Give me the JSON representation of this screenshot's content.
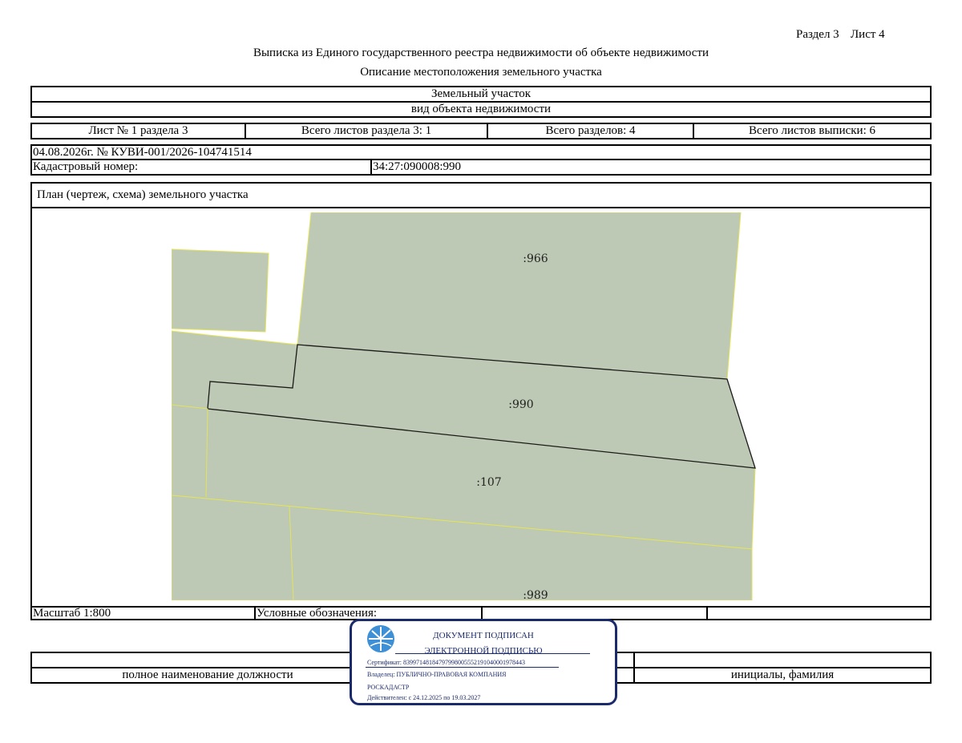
{
  "header": {
    "section": "Раздел 3",
    "sheet": "Лист 4",
    "title": "Выписка из Единого государственного реестра недвижимости об объекте недвижимости",
    "subtitle": "Описание местоположения земельного участка"
  },
  "object": {
    "type": "Земельный участок",
    "type_caption": "вид объекта недвижимости"
  },
  "sheet_info": [
    "Лист № 1 раздела 3",
    "Всего листов раздела 3: 1",
    "Всего разделов: 4",
    "Всего листов выписки: 6"
  ],
  "record": {
    "date_number": "04.08.2026г. № КУВИ-001/2026-104741514",
    "cadastral_label": "Кадастровый номер:",
    "cadastral_number": "34:27:090008:990"
  },
  "plan": {
    "title": "План (чертеж, схема) земельного участка",
    "parcels": [
      ":966",
      ":990",
      ":107",
      ":989"
    ],
    "colors": {
      "parcel_fill": "#bdc9b5",
      "boundary": "#e3e35a",
      "subject_boundary": "#1a1a1a"
    }
  },
  "footer": {
    "scale": "Масштаб 1:800",
    "legend_label": "Условные обозначения:"
  },
  "signature": {
    "position_caption": "полное наименование должности",
    "name_caption": "инициалы, фамилия"
  },
  "stamp": {
    "line1": "ДОКУМЕНТ ПОДПИСАН",
    "line2": "ЭЛЕКТРОННОЙ ПОДПИСЬЮ",
    "certificate": "Сертификат: 83997148184797998005552191040001978443",
    "owner": "Владелец: ПУБЛИЧНО-ПРАВОВАЯ КОМПАНИЯ",
    "owner_cont": "РОСКАДАСТР",
    "valid": "Действителен: с 24.12.2025 по 19.03.2027",
    "color": "#1b2a6b",
    "logo_color": "#3d8fd6"
  }
}
